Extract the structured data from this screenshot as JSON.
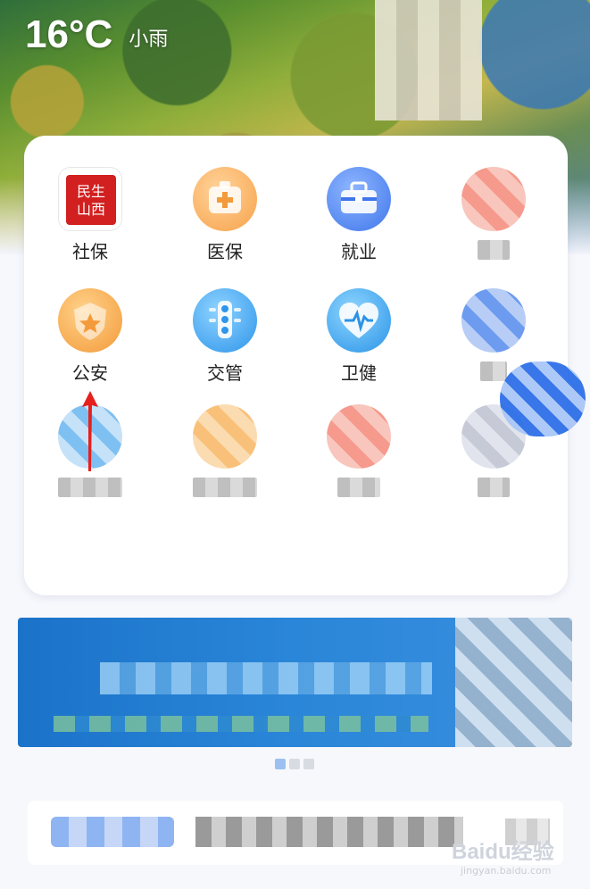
{
  "weather": {
    "temperature": "16°C",
    "condition": "小雨"
  },
  "services": [
    {
      "label": "社保",
      "icon": "shebao-seal-icon"
    },
    {
      "label": "医保",
      "icon": "medical-kit-icon"
    },
    {
      "label": "就业",
      "icon": "toolbox-icon"
    },
    {
      "label": "",
      "icon": "blurred-red-icon"
    },
    {
      "label": "公安",
      "icon": "police-star-icon"
    },
    {
      "label": "交管",
      "icon": "traffic-light-icon"
    },
    {
      "label": "卫健",
      "icon": "heart-pulse-icon"
    },
    {
      "label": "",
      "icon": "blurred-blue-icon"
    },
    {
      "label": "",
      "icon": "blurred-lightblue-icon"
    },
    {
      "label": "",
      "icon": "blurred-orange-icon"
    },
    {
      "label": "",
      "icon": "blurred-red-icon"
    },
    {
      "label": "",
      "icon": "blurred-gray-icon"
    }
  ],
  "seal_text": "民生山西",
  "watermark": {
    "brand": "Baidu经验",
    "url": "jingyan.baidu.com"
  },
  "colors": {
    "accent": "#3f76ea",
    "arrow": "#e5201d",
    "card": "#ffffff"
  }
}
